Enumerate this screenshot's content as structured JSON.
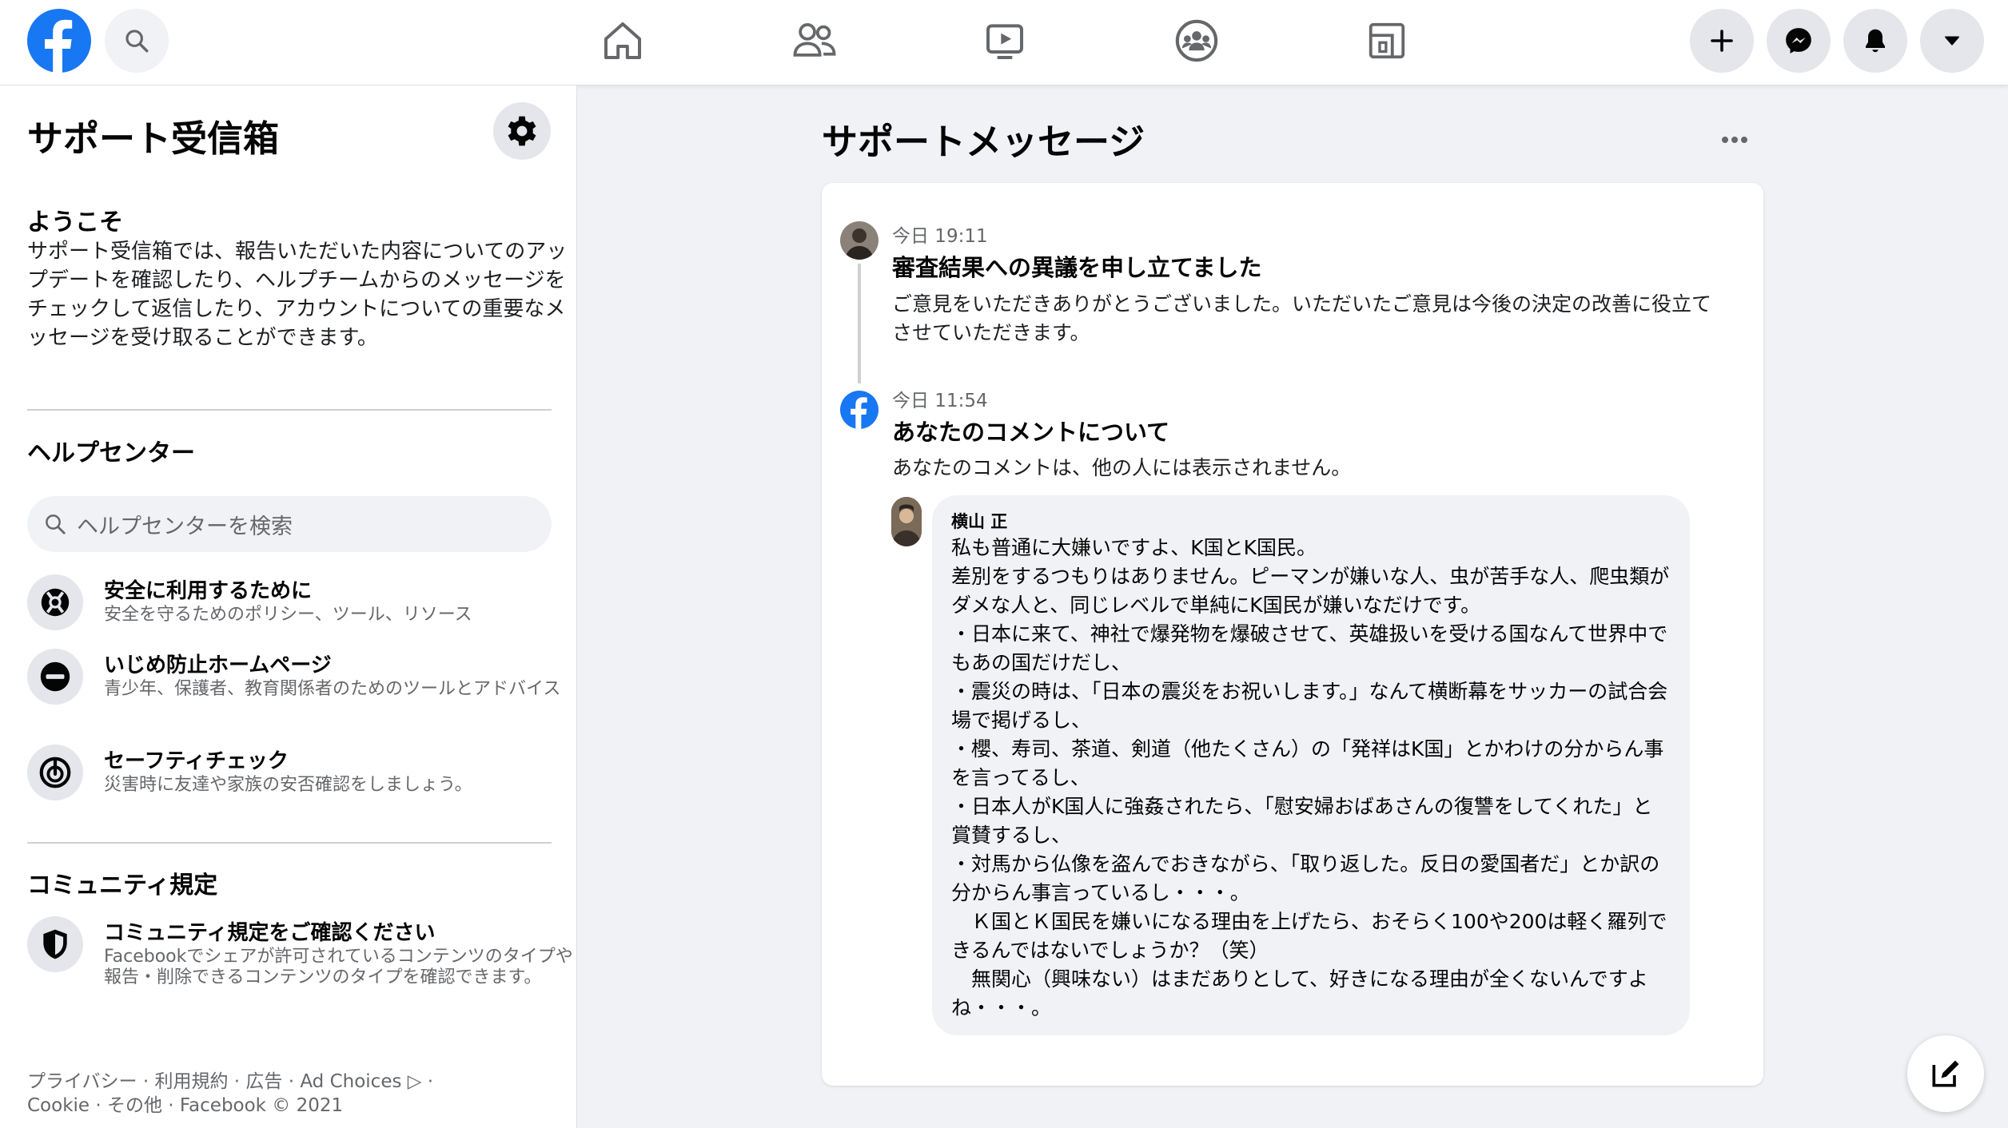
{
  "topbar": {
    "logo": "facebook-logo",
    "icons": [
      "search-icon",
      "home-icon",
      "friends-icon",
      "watch-icon",
      "groups-icon",
      "gaming-icon",
      "plus-icon",
      "messenger-icon",
      "bell-icon",
      "caret-down-icon"
    ]
  },
  "sidebar": {
    "title": "サポート受信箱",
    "welcome_heading": "ようこそ",
    "welcome_text": "サポート受信箱では、報告いただいた内容についてのアップデートを確認したり、ヘルプチームからのメッセージをチェックして返信したり、アカウントについての重要なメッセージを受け取ることができます。",
    "help_center_heading": "ヘルプセンター",
    "help_search_placeholder": "ヘルプセンターを検索",
    "help_items": [
      {
        "title": "安全に利用するために",
        "desc": "安全を守るためのポリシー、ツール、リソース",
        "icon": "lifebuoy-icon"
      },
      {
        "title": "いじめ防止ホームページ",
        "desc": "青少年、保護者、教育関係者のためのツールとアドバイス",
        "icon": "no-entry-icon"
      },
      {
        "title": "セーフティチェック",
        "desc": "災害時に友達や家族の安否確認をしましょう。",
        "icon": "safety-check-icon"
      }
    ],
    "community_heading": "コミュニティ規定",
    "community_item": {
      "title": "コミュニティ規定をご確認ください",
      "desc": "Facebookでシェアが許可されているコンテンツのタイプや報告・削除できるコンテンツのタイプを確認できます。",
      "icon": "shield-icon"
    },
    "footer_line1": "プライバシー · 利用規約 · 広告 · Ad Choices ▷ ·",
    "footer_line2": "Cookie · その他 · Facebook © 2021"
  },
  "main": {
    "title": "サポートメッセージ",
    "messages": [
      {
        "time": "今日 19:11",
        "title": "審査結果への異議を申し立てました",
        "body": "ご意見をいただきありがとうございました。いただいたご意見は今後の決定の改善に役立てさせていただきます。"
      },
      {
        "time": "今日 11:54",
        "title": "あなたのコメントについて",
        "body": "あなたのコメントは、他の人には表示されません。"
      }
    ],
    "comment": {
      "author": "横山 正",
      "text": "私も普通に大嫌いですよ、K国とK国民。\n差別をするつもりはありません。ピーマンが嫌いな人、虫が苦手な人、爬虫類がダメな人と、同じレベルで単純にK国民が嫌いなだけです。\n・日本に来て、神社で爆発物を爆破させて、英雄扱いを受ける国なんて世界中でもあの国だけだし、\n・震災の時は、「日本の震災をお祝いします。」なんて横断幕をサッカーの試合会場で掲げるし、\n・櫻、寿司、茶道、剣道（他たくさん）の「発祥はK国」とかわけの分からん事を言ってるし、\n・日本人がK国人に強姦されたら、「慰安婦おばあさんの復讐をしてくれた」と賞賛するし、\n・対馬から仏像を盗んでおきながら、「取り返した。反日の愛国者だ」とか訳の分からん事言っているし・・・。\n　Ｋ国とＫ国民を嫌いになる理由を上げたら、おそらく100や200は軽く羅列できるんではないでしょうか？（笑）\n　無関心（興味ない）はまだありとして、好きになる理由が全くないんですよね・・・。"
    }
  },
  "colors": {
    "brand": "#1877f2",
    "bg": "#f0f2f5",
    "secondary_text": "#65676b"
  }
}
